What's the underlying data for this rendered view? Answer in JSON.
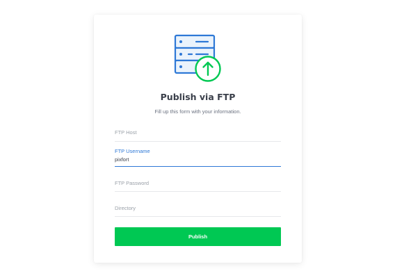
{
  "form": {
    "title": "Publish via FTP",
    "subtitle": "Fill up this form with your information.",
    "fields": [
      {
        "label": "FTP Host",
        "value": "",
        "placeholder": ""
      },
      {
        "label": "FTP Username",
        "value": "pixfort",
        "placeholder": ""
      },
      {
        "label": "FTP Password",
        "value": "",
        "placeholder": ""
      },
      {
        "label": "Directory",
        "value": "",
        "placeholder": ""
      }
    ],
    "submit_label": "Publish",
    "illustration_icon": "server-upload-icon"
  },
  "colors": {
    "accent": "#2d78d6",
    "button": "#00c853",
    "title": "#3a3f4a",
    "label": "#9aa0a8"
  }
}
